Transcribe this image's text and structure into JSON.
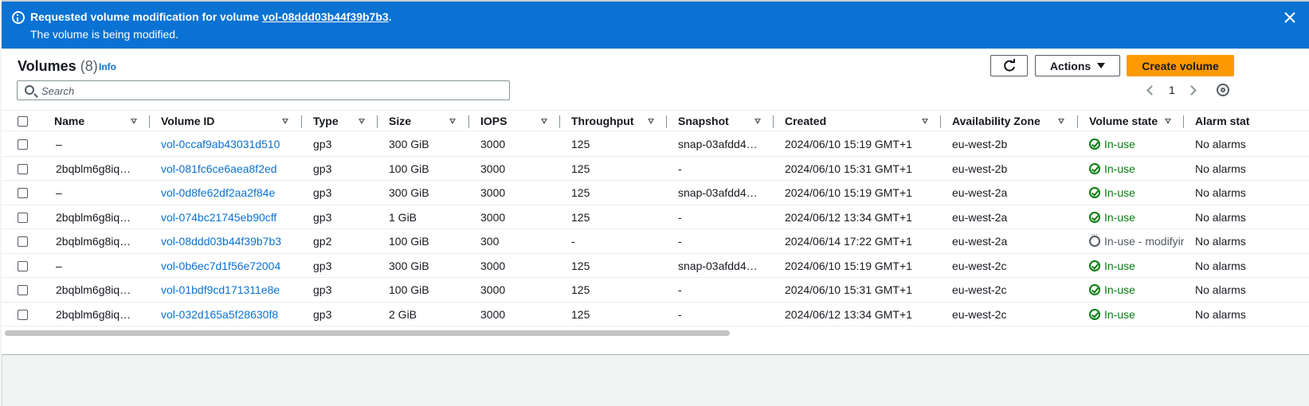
{
  "flash": {
    "prefix": "Requested volume modification for volume",
    "volume_id": "vol-08ddd03b44f39b7b3",
    "suffix": ".",
    "message": "The volume is being modified."
  },
  "header": {
    "title": "Volumes",
    "count": "(8)",
    "info": "Info",
    "actions_label": "Actions",
    "create_label": "Create volume"
  },
  "search": {
    "placeholder": "Search"
  },
  "pagination": {
    "page": "1"
  },
  "columns": [
    "Name",
    "Volume ID",
    "Type",
    "Size",
    "IOPS",
    "Throughput",
    "Snapshot",
    "Created",
    "Availability Zone",
    "Volume state",
    "Alarm stat"
  ],
  "rows": [
    {
      "name": "–",
      "id": "vol-0ccaf9ab43031d510",
      "type": "gp3",
      "size": "300 GiB",
      "iops": "3000",
      "throughput": "125",
      "snapshot": "snap-03afdd4…",
      "created": "2024/06/10 15:19 GMT+1",
      "az": "eu-west-2b",
      "state": "In-use",
      "alarm": "No alarms"
    },
    {
      "name": "2bqblm6g8iq…",
      "id": "vol-081fc6ce6aea8f2ed",
      "type": "gp3",
      "size": "100 GiB",
      "iops": "3000",
      "throughput": "125",
      "snapshot": "-",
      "created": "2024/06/10 15:31 GMT+1",
      "az": "eu-west-2b",
      "state": "In-use",
      "alarm": "No alarms"
    },
    {
      "name": "–",
      "id": "vol-0d8fe62df2aa2f84e",
      "type": "gp3",
      "size": "300 GiB",
      "iops": "3000",
      "throughput": "125",
      "snapshot": "snap-03afdd4…",
      "created": "2024/06/10 15:19 GMT+1",
      "az": "eu-west-2a",
      "state": "In-use",
      "alarm": "No alarms"
    },
    {
      "name": "2bqblm6g8iq…",
      "id": "vol-074bc21745eb90cff",
      "type": "gp3",
      "size": "1 GiB",
      "iops": "3000",
      "throughput": "125",
      "snapshot": "-",
      "created": "2024/06/12 13:34 GMT+1",
      "az": "eu-west-2a",
      "state": "In-use",
      "alarm": "No alarms"
    },
    {
      "name": "2bqblm6g8iq…",
      "id": "vol-08ddd03b44f39b7b3",
      "type": "gp2",
      "size": "100 GiB",
      "iops": "300",
      "throughput": "-",
      "snapshot": "-",
      "created": "2024/06/14 17:22 GMT+1",
      "az": "eu-west-2a",
      "state": "In-use - modifyir",
      "alarm": "No alarms"
    },
    {
      "name": "–",
      "id": "vol-0b6ec7d1f56e72004",
      "type": "gp3",
      "size": "300 GiB",
      "iops": "3000",
      "throughput": "125",
      "snapshot": "snap-03afdd4…",
      "created": "2024/06/10 15:19 GMT+1",
      "az": "eu-west-2c",
      "state": "In-use",
      "alarm": "No alarms"
    },
    {
      "name": "2bqblm6g8iq…",
      "id": "vol-01bdf9cd171311e8e",
      "type": "gp3",
      "size": "100 GiB",
      "iops": "3000",
      "throughput": "125",
      "snapshot": "-",
      "created": "2024/06/10 15:31 GMT+1",
      "az": "eu-west-2c",
      "state": "In-use",
      "alarm": "No alarms"
    },
    {
      "name": "2bqblm6g8iq…",
      "id": "vol-032d165a5f28630f8",
      "type": "gp3",
      "size": "2 GiB",
      "iops": "3000",
      "throughput": "125",
      "snapshot": "-",
      "created": "2024/06/12 13:34 GMT+1",
      "az": "eu-west-2c",
      "state": "In-use",
      "alarm": "No alarms"
    }
  ],
  "colors": {
    "flash_bg": "#0972d3",
    "primary": "#ff9900",
    "link": "#0972d3",
    "success": "#037f0c"
  }
}
